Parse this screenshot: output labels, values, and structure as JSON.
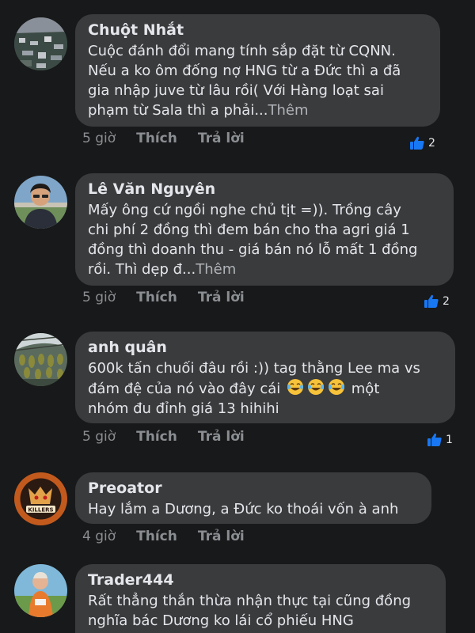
{
  "comments": [
    {
      "author": "Chuột Nhắt",
      "text": "Cuộc đánh đổi mang tính sắp đặt từ CQNN.\nNếu a ko ôm đống nợ HNG từ a Đức thì a đã\ngia nhập juve từ lâu rồi( Với Hàng loạt sai\nphạm từ Sala thì a phải...",
      "more": "Thêm",
      "time": "5 giờ",
      "like_label": "Thích",
      "reply_label": "Trả lời",
      "likes": "2",
      "avatar_icon": "aerial-city-avatar"
    },
    {
      "author": "Lê Văn Nguyên",
      "text": "Mấy ông cứ ngồi nghe chủ tịt =)). Trồng cây\nchi phí 2 đồng thì đem bán cho tha agri giá 1\nđồng thì doanh thu - giá bán nó lỗ mất 1 đồng\nrồi. Thì dẹp đ...",
      "more": "Thêm",
      "time": "5 giờ",
      "like_label": "Thích",
      "reply_label": "Trả lời",
      "likes": "2",
      "avatar_icon": "man-portrait-avatar"
    },
    {
      "author": "anh quân",
      "text_line1": "600k tấn chuối đâu rồi :)) tag thằng Lee ma vs",
      "text_line2a": "đám đệ của nó vào đây cái",
      "text_line2b": " một",
      "text_line3": "nhóm đu đỉnh giá 13 hihihi",
      "emoji": "laughing-tears-emoji",
      "time": "5 giờ",
      "like_label": "Thích",
      "reply_label": "Trả lời",
      "likes": "1",
      "avatar_icon": "banana-plantation-avatar"
    },
    {
      "author": "Preoator",
      "text": "Hay lắm a Dương, a Đức ko thoái vốn à anh",
      "time": "4 giờ",
      "like_label": "Thích",
      "reply_label": "Trả lời",
      "avatar_icon": "killers-logo-avatar"
    },
    {
      "author": "Trader444",
      "text": "Rất thẳng thắn thừa nhận thực tại cũng đồng\nnghĩa bác Dương ko lái cổ phiếu HNG",
      "avatar_icon": "runner-portrait-avatar"
    }
  ],
  "colors": {
    "background": "#18191a",
    "bubble": "#3a3b3c",
    "text": "#e4e6eb",
    "meta": "#8a8d91",
    "like_blue": "#1877f2"
  }
}
